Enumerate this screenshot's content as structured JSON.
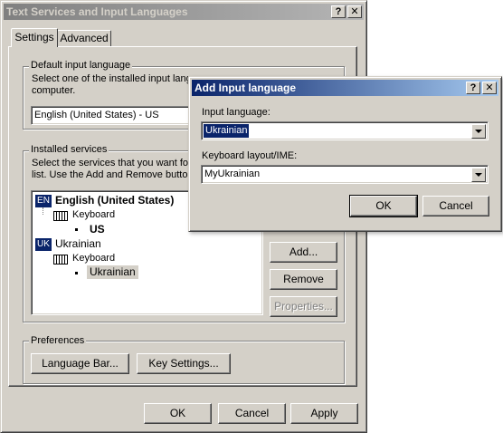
{
  "main_window": {
    "title": "Text Services and Input Languages",
    "help_btn": "?",
    "close_btn": "✕",
    "tabs": [
      {
        "label": "Settings"
      },
      {
        "label": "Advanced"
      }
    ],
    "default_input": {
      "group_label": "Default input language",
      "description_line1": "Select one of the installed input langu",
      "description_line2": "computer.",
      "selected_value": "English (United States) - US"
    },
    "installed_services": {
      "group_label": "Installed services",
      "description_line1": "Select the services that you want for",
      "description_line2": "list. Use the Add and Remove button",
      "tree": [
        {
          "badge": "EN",
          "language": "English (United States)",
          "service": "Keyboard",
          "layout": "US"
        },
        {
          "badge": "UK",
          "language": "Ukrainian",
          "service": "Keyboard",
          "layout": "Ukrainian"
        }
      ],
      "add_label": "Add...",
      "remove_label": "Remove",
      "properties_label": "Properties..."
    },
    "preferences": {
      "group_label": "Preferences",
      "language_bar_label": "Language Bar...",
      "key_settings_label": "Key Settings..."
    },
    "footer": {
      "ok_label": "OK",
      "cancel_label": "Cancel",
      "apply_label": "Apply"
    }
  },
  "dialog": {
    "title": "Add Input language",
    "help_btn": "?",
    "close_btn": "✕",
    "input_language_label": "Input language:",
    "input_language_value": "Ukrainian",
    "keyboard_layout_label": "Keyboard layout/IME:",
    "keyboard_layout_value": "MyUkrainian",
    "ok_label": "OK",
    "cancel_label": "Cancel"
  },
  "colors": {
    "dialog_face": "#d4d0c8",
    "active_title": "#0a246a",
    "inactive_title": "#808080",
    "selection": "#0a246a"
  }
}
